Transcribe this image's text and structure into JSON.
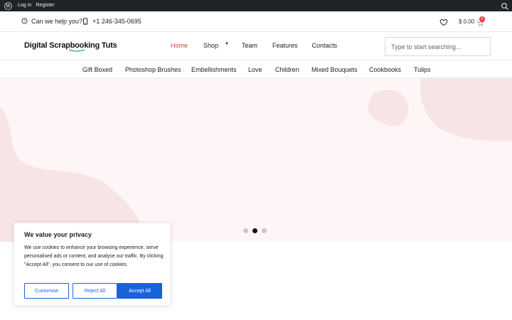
{
  "adminbar": {
    "login": "Log In",
    "register": "Register"
  },
  "topbar": {
    "help": "Can we help you?",
    "phone": "+1 246-345-0695",
    "cart_total": "$ 0.00",
    "cart_count": "0"
  },
  "header": {
    "logo": "Digital Scrapbooking Tuts",
    "nav": [
      "Home",
      "Shop",
      "Team",
      "Features",
      "Contacts"
    ],
    "search_placeholder": "Type to start searching..."
  },
  "categories": [
    "Gift Boxed",
    "Photoshop Brushes",
    "Embellishments",
    "Love",
    "Children",
    "Mixed Bouquets",
    "Cookbooks",
    "Tulips"
  ],
  "slider": {
    "active_index": 1,
    "count": 3
  },
  "cookie": {
    "title": "We value your privacy",
    "body": "We use cookies to enhance your browsing experience, serve personalised ads or content, and analyse our traffic. By clicking \"Accept All\", you consent to our use of cookies.",
    "customise": "Customise",
    "reject": "Reject All",
    "accept": "Accept All"
  },
  "colors": {
    "accent": "#d0433c",
    "button": "#1863dc",
    "hero_bg": "#fdf5f6",
    "hero_shape": "#f6e4e7",
    "admin_bar": "#1d2327"
  },
  "icons": [
    "wordpress-icon",
    "search-icon",
    "help-circle-icon",
    "phone-icon",
    "heart-icon",
    "cart-icon",
    "caret-down-icon"
  ]
}
